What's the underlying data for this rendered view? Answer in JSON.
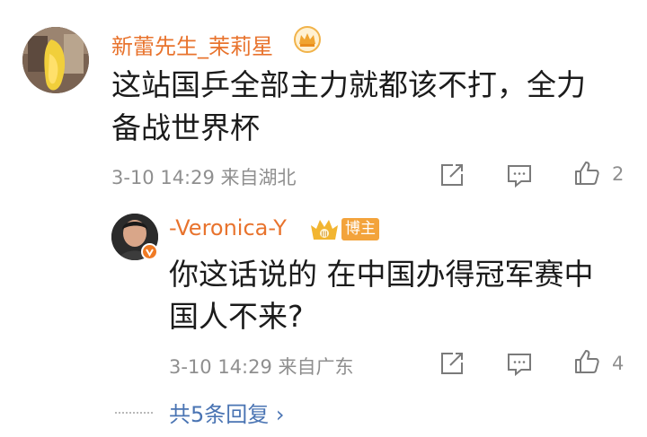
{
  "comment": {
    "username": "新蕾先生_茉莉星",
    "text_line1": "这站国乒全部主力就都该不打，全力",
    "text_line2": "备战世界杯",
    "meta": "3-10 14:29 来自湖北",
    "like_count": "2"
  },
  "reply": {
    "username": "-Veronica-Y",
    "author_badge": "博主",
    "text_line1": "你这话说的 在中国办得冠军赛中",
    "text_line2": "国人不来?",
    "meta": "3-10 14:29 来自广东",
    "like_count": "4"
  },
  "more_replies": "共5条回复 ›",
  "colors": {
    "username": "#e8732d",
    "meta": "#8f8f8f",
    "link": "#4a74b3",
    "badge": "#f3a33b"
  }
}
